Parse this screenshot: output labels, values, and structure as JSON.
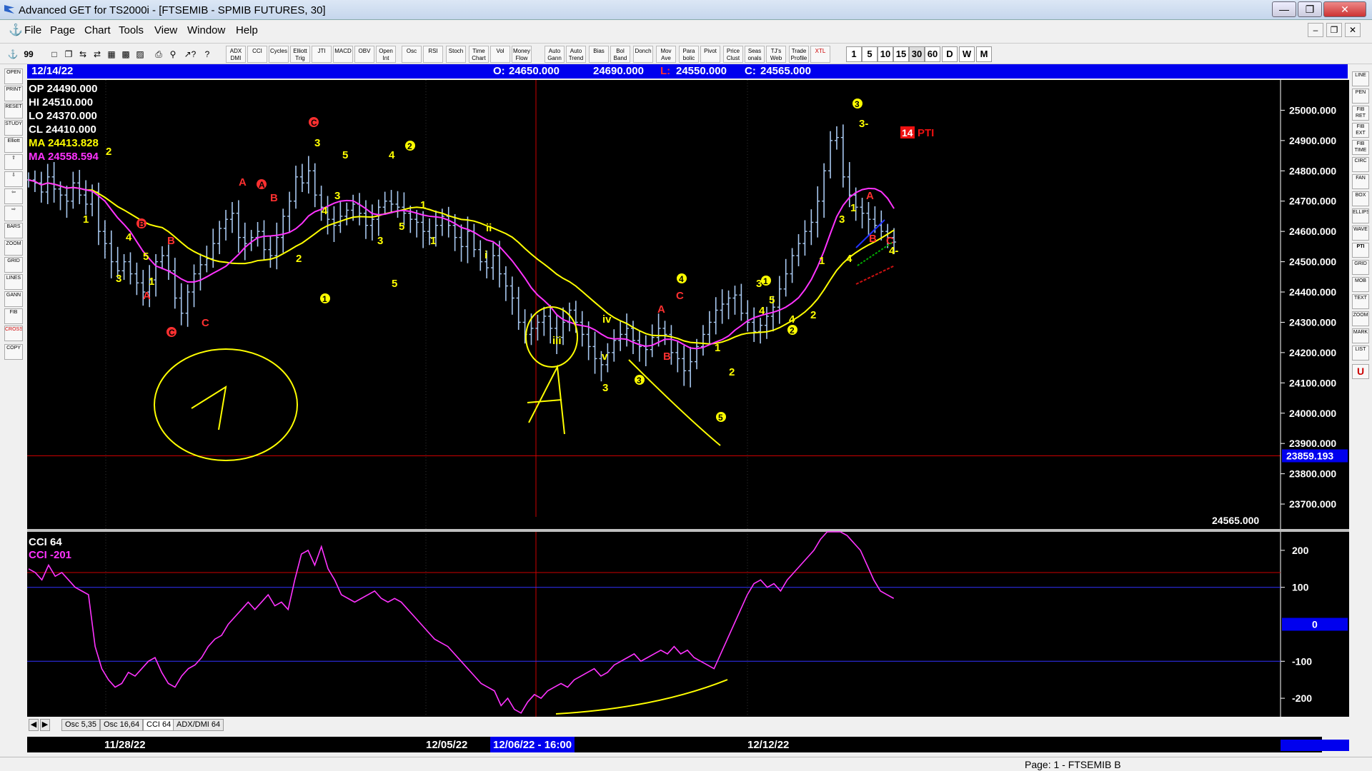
{
  "window": {
    "title": "Advanced GET for TS2000i - [FTSEMIB - SPMIB FUTURES, 30]"
  },
  "menu": {
    "items": [
      "File",
      "Page",
      "Chart",
      "Tools",
      "View",
      "Window",
      "Help"
    ]
  },
  "toolbar": {
    "study_buttons": [
      "ADX DMI",
      "CCI",
      "Cycles",
      "Elliott Trig",
      "JTI",
      "MACD",
      "OBV",
      "Open Int",
      "Osc",
      "RSI",
      "Stoch",
      "Time Chart",
      "Vol",
      "Money Flow",
      "Auto Gann",
      "Auto Trend",
      "Bias",
      "Bol Band",
      "Donch",
      "Mov Ave",
      "Para bolic",
      "Pivot",
      "Price Clust",
      "Seas onals",
      "TJ's Web",
      "Trade Profile",
      "XTL"
    ],
    "periods": [
      "1",
      "5",
      "10",
      "15",
      "30",
      "60",
      "D",
      "W",
      "M"
    ],
    "active_period": "30"
  },
  "left_tools": [
    "OPEN",
    "PRINT",
    "RESET",
    "STUDY",
    "Elliott",
    "UP",
    "DOWN",
    "LEFT",
    "RIGHT",
    "BARS",
    "ZOOM",
    "GRID",
    "LINES",
    "GANN",
    "FIB",
    "CROSS",
    "COPY"
  ],
  "right_tools": [
    "LINE",
    "PEN",
    "FIB RET",
    "FIB EXT",
    "FIB TIME",
    "CIRC",
    "FAN",
    "BOX",
    "ELLIPS",
    "WAVE",
    "PTI",
    "GRID",
    "MOB",
    "TEXT",
    "ZOOM",
    "MARK",
    "LIST",
    "U"
  ],
  "info_bar": {
    "date": "12/14/22",
    "open_label": "O:",
    "open_value": "24650.000",
    "high_value": "24690.000",
    "low_label": "L:",
    "low_value": "24550.000",
    "close_label": "C:",
    "close_value": "24565.000"
  },
  "price_readout": {
    "op": "OP  24490.000",
    "hi": "HI   24510.000",
    "lo": "LO  24370.000",
    "cl": "CL  24410.000",
    "ma1": "MA  24413.828",
    "ma2": "MA  24558.594"
  },
  "chart_data": [
    {
      "type": "candlestick",
      "title": "FTSEMIB - SPMIB FUTURES, 30",
      "ylim": [
        23620,
        25100
      ],
      "y_ticks": [
        "25000.000",
        "24900.000",
        "24800.000",
        "24700.000",
        "24600.000",
        "24500.000",
        "24400.000",
        "24300.000",
        "24200.000",
        "24100.000",
        "24000.000",
        "23900.000",
        "23800.000",
        "23700.000"
      ],
      "y_tick_values": [
        25000,
        24900,
        24800,
        24700,
        24600,
        24500,
        24400,
        24300,
        24200,
        24100,
        24000,
        23900,
        23800,
        23700
      ],
      "horizontal_line_label": "23859.193",
      "horizontal_line_value": 23859.193,
      "last_price_label": "24565.000",
      "x_dates": [
        "11/28/22",
        "12/05/22",
        "12/06/22 - 16:00",
        "12/12/22"
      ],
      "series": [
        {
          "name": "Price",
          "values": [
            24770,
            24760,
            24730,
            24780,
            24740,
            24720,
            24700,
            24760,
            24720,
            24690,
            24730,
            24600,
            24560,
            24500,
            24470,
            24500,
            24460,
            24430,
            24400,
            24440,
            24500,
            24520,
            24470,
            24380,
            24330,
            24400,
            24460,
            24490,
            24510,
            24560,
            24610,
            24640,
            24660,
            24580,
            24560,
            24580,
            24600,
            24540,
            24520,
            24580,
            24650,
            24700,
            24780,
            24760,
            24800,
            24720,
            24680,
            24640,
            24620,
            24650,
            24670,
            24690,
            24660,
            24620,
            24640,
            24680,
            24700,
            24690,
            24680,
            24660,
            24640,
            24630,
            24600,
            24580,
            24620,
            24650,
            24620,
            24580,
            24550,
            24600,
            24540,
            24500,
            24480,
            24520,
            24460,
            24420,
            24380,
            24300,
            24260,
            24280,
            24300,
            24320,
            24280,
            24250,
            24300,
            24340,
            24300,
            24260,
            24220,
            24180,
            24160,
            24200,
            24240,
            24260,
            24280,
            24240,
            24220,
            24210,
            24250,
            24280,
            24260,
            24200,
            24180,
            24140,
            24170,
            24220,
            24260,
            24300,
            24340,
            24360,
            24380,
            24390,
            24330,
            24300,
            24270,
            24290,
            24320,
            24350,
            24410,
            24460,
            24520,
            24560,
            24600,
            24630,
            24700,
            24800,
            24900,
            24910,
            24780,
            24720,
            24680,
            24660,
            24640,
            24620,
            24600,
            24580,
            24565
          ]
        },
        {
          "name": "MA 24413.828",
          "color": "#ffff00"
        },
        {
          "name": "MA 24558.594",
          "color": "#ff33ff"
        }
      ],
      "annotations": {
        "pti_badge": "14",
        "pti_label": "PTI",
        "elliott_labels": [
          "1",
          "2",
          "3",
          "4",
          "5",
          "A",
          "B",
          "C",
          "i",
          "ii",
          "iii",
          "iv",
          "v",
          "3-",
          "4-",
          "5"
        ]
      }
    },
    {
      "type": "line",
      "title": "CCI 64",
      "series": [
        {
          "name": "CCI -201",
          "color": "#ff33ff"
        }
      ],
      "ylim": [
        -250,
        250
      ],
      "y_ticks": [
        "200",
        "100",
        "-100",
        "-200"
      ],
      "y_tick_values": [
        200,
        100,
        -100,
        -200
      ],
      "zero_label": "0",
      "values": [
        150,
        140,
        120,
        160,
        130,
        140,
        120,
        100,
        90,
        80,
        -60,
        -120,
        -150,
        -170,
        -160,
        -130,
        -140,
        -120,
        -100,
        -90,
        -130,
        -160,
        -170,
        -140,
        -120,
        -110,
        -90,
        -60,
        -40,
        -30,
        0,
        20,
        40,
        60,
        40,
        60,
        80,
        50,
        60,
        40,
        120,
        190,
        200,
        160,
        210,
        150,
        120,
        80,
        70,
        60,
        70,
        80,
        90,
        70,
        60,
        70,
        60,
        40,
        20,
        0,
        -20,
        -40,
        -50,
        -60,
        -80,
        -100,
        -120,
        -140,
        -160,
        -170,
        -180,
        -220,
        -200,
        -230,
        -240,
        -210,
        -190,
        -200,
        -180,
        -170,
        -160,
        -170,
        -150,
        -140,
        -130,
        -120,
        -140,
        -130,
        -110,
        -100,
        -90,
        -80,
        -100,
        -90,
        -80,
        -70,
        -80,
        -60,
        -80,
        -70,
        -90,
        -100,
        -110,
        -120,
        -80,
        -40,
        0,
        40,
        80,
        110,
        120,
        100,
        110,
        90,
        120,
        140,
        160,
        180,
        200,
        230,
        260,
        280,
        260,
        240,
        220,
        200,
        160,
        120,
        90,
        80,
        70
      ]
    }
  ],
  "osc_tabs": [
    "Osc 5,35",
    "Osc 16,64",
    "CCI 64",
    "ADX/DMI 64"
  ],
  "active_osc_tab": "CCI 64",
  "status": {
    "page": "Page: 1 - FTSEMIB B"
  }
}
